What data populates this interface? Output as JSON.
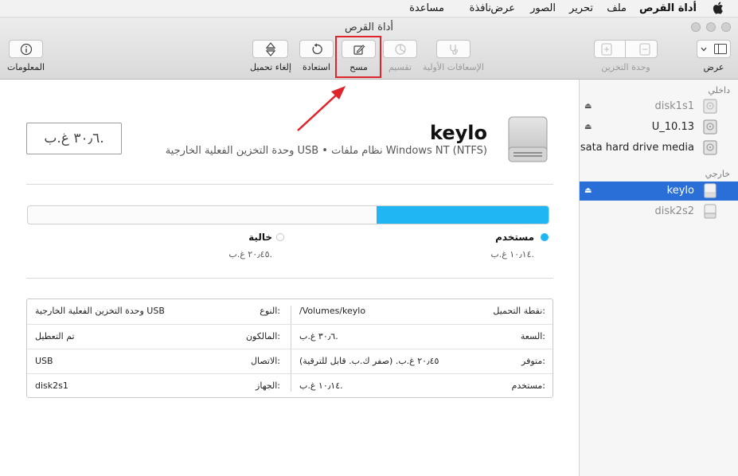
{
  "menubar": {
    "app_name": "أداة القرص",
    "items": [
      "ملف",
      "تحرير",
      "الصور",
      "عرض",
      "نافذة",
      "مساعدة"
    ]
  },
  "window": {
    "title": "أداة القرص"
  },
  "toolbar": {
    "info_label": "المعلومات",
    "unmount_label": "إلغاء تحميل",
    "restore_label": "استعادة",
    "erase_label": "مسح",
    "partition_label": "تقسيم",
    "first_aid_label": "الإسعافات الأولية",
    "storage_label": "وحدة التخزين",
    "view_label": "عرض"
  },
  "sidebar": {
    "internal_header": "داخلي",
    "external_header": "خارجي",
    "internal_items": [
      {
        "label": "disk1s1",
        "dim": true,
        "eject": true
      },
      {
        "label": "U_10.13",
        "dim": false,
        "eject": true
      },
      {
        "label": "sata hard drive media",
        "dim": false,
        "eject": false
      }
    ],
    "external_items": [
      {
        "label": "keylo",
        "selected": true,
        "eject": true
      },
      {
        "label": "disk2s2",
        "dim": true,
        "eject": false
      }
    ]
  },
  "disk": {
    "name": "keylo",
    "description": "وحدة التخزين الفعلية الخارجية USB • نظام ملفات Windows NT (NTFS)",
    "size_display": "٣٠٫٦ غ.ب."
  },
  "usage": {
    "used_label": "مستخدم",
    "used_value": "١٠٫١٤ غ.ب.",
    "free_label": "خالية",
    "free_value": "٢٠٫٤٥ غ.ب.",
    "used_fraction": 0.331,
    "used_color": "#1fb6f3"
  },
  "info": {
    "rows": [
      {
        "l_label": "نقطة التحميل:",
        "l_value": "/Volumes/keylo",
        "r_label": "النوع:",
        "r_value": "وحدة التخزين الفعلية الخارجية USB"
      },
      {
        "l_label": "السعة:",
        "l_value": "٣٠٫٦ غ.ب.",
        "r_label": "المالكون:",
        "r_value": "تم التعطيل"
      },
      {
        "l_label": "متوفر:",
        "l_value": "٢٠٫٤٥ غ.ب. (صفر ك.ب. قابل للترقية)",
        "r_label": "الاتصال:",
        "r_value": "USB"
      },
      {
        "l_label": "مستخدم:",
        "l_value": "١٠٫١٤ غ.ب.",
        "r_label": "الجهاز:",
        "r_value": "disk2s1"
      }
    ]
  }
}
